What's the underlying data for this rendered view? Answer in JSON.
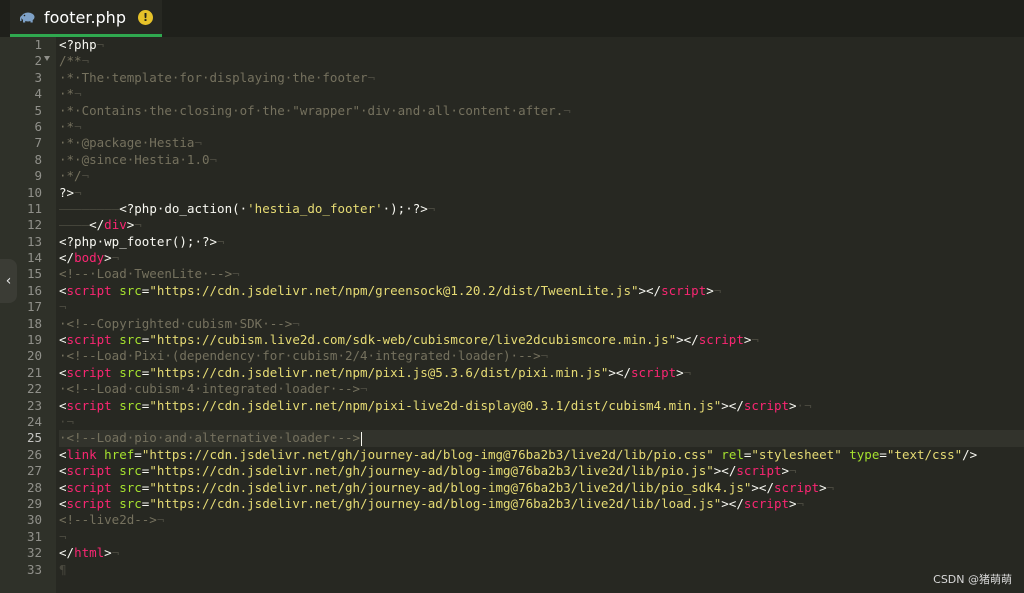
{
  "tab": {
    "title": "footer.php",
    "warning_glyph": "!",
    "icon": "php-elephant-icon"
  },
  "collapse_glyph": "‹",
  "watermark": "CSDN @猪萌萌",
  "active_line": 25,
  "colors": {
    "tag": "#f92672",
    "attr": "#a6e22e",
    "string": "#e6db74",
    "comment": "#75715e",
    "text": "#f8f8f2",
    "accent": "#2fa84f"
  },
  "lines": [
    {
      "n": "1",
      "t": [
        [
          "fn",
          "<?php"
        ],
        [
          "inv",
          "¬"
        ]
      ]
    },
    {
      "n": "2",
      "t": [
        [
          "cm",
          "/**"
        ],
        [
          "inv",
          "¬"
        ]
      ]
    },
    {
      "n": "3",
      "t": [
        [
          "cm",
          "·*·The·template·for·displaying·the·footer"
        ],
        [
          "inv",
          "¬"
        ]
      ]
    },
    {
      "n": "4",
      "t": [
        [
          "cm",
          "·*"
        ],
        [
          "inv",
          "¬"
        ]
      ]
    },
    {
      "n": "5",
      "t": [
        [
          "cm",
          "·*·Contains·the·closing·of·the·\"wrapper\"·div·and·all·content·after."
        ],
        [
          "inv",
          "¬"
        ]
      ]
    },
    {
      "n": "6",
      "t": [
        [
          "cm",
          "·*"
        ],
        [
          "inv",
          "¬"
        ]
      ]
    },
    {
      "n": "7",
      "t": [
        [
          "cm",
          "·*·@package·Hestia"
        ],
        [
          "inv",
          "¬"
        ]
      ]
    },
    {
      "n": "8",
      "t": [
        [
          "cm",
          "·*·@since·Hestia·1.0"
        ],
        [
          "inv",
          "¬"
        ]
      ]
    },
    {
      "n": "9",
      "t": [
        [
          "cm",
          "·*/"
        ],
        [
          "inv",
          "¬"
        ]
      ]
    },
    {
      "n": "10",
      "t": [
        [
          "fn",
          "?>"
        ],
        [
          "inv",
          "¬"
        ]
      ]
    },
    {
      "n": "11",
      "t": [
        [
          "inv",
          "————————"
        ],
        [
          "fn",
          "<?php·do_action(·"
        ],
        [
          "st",
          "'hestia_do_footer'"
        ],
        [
          "fn",
          "·);·?>"
        ],
        [
          "inv",
          "¬"
        ]
      ]
    },
    {
      "n": "12",
      "t": [
        [
          "inv",
          "————"
        ],
        [
          "fn",
          "</"
        ],
        [
          "kw",
          "div"
        ],
        [
          "fn",
          ">"
        ],
        [
          "inv",
          "¬"
        ]
      ]
    },
    {
      "n": "13",
      "t": [
        [
          "fn",
          "<?php·wp_footer();·?>"
        ],
        [
          "inv",
          "¬"
        ]
      ]
    },
    {
      "n": "14",
      "t": [
        [
          "fn",
          "</"
        ],
        [
          "kw",
          "body"
        ],
        [
          "fn",
          ">"
        ],
        [
          "inv",
          "¬"
        ]
      ]
    },
    {
      "n": "15",
      "t": [
        [
          "cm",
          "<!--·Load·TweenLite·-->"
        ],
        [
          "inv",
          "¬"
        ]
      ]
    },
    {
      "n": "16",
      "t": [
        [
          "fn",
          "<"
        ],
        [
          "kw",
          "script"
        ],
        [
          "fn",
          " "
        ],
        [
          "at",
          "src"
        ],
        [
          "fn",
          "="
        ],
        [
          "st",
          "\"https://cdn.jsdelivr.net/npm/greensock@1.20.2/dist/TweenLite.js\""
        ],
        [
          "fn",
          "></"
        ],
        [
          "kw",
          "script"
        ],
        [
          "fn",
          ">"
        ],
        [
          "inv",
          "¬"
        ]
      ]
    },
    {
      "n": "17",
      "t": [
        [
          "inv",
          "¬"
        ]
      ]
    },
    {
      "n": "18",
      "t": [
        [
          "cm",
          "·<!--Copyrighted·cubism·SDK·-->"
        ],
        [
          "inv",
          "¬"
        ]
      ]
    },
    {
      "n": "19",
      "t": [
        [
          "fn",
          "<"
        ],
        [
          "kw",
          "script"
        ],
        [
          "fn",
          " "
        ],
        [
          "at",
          "src"
        ],
        [
          "fn",
          "="
        ],
        [
          "st",
          "\"https://cubism.live2d.com/sdk-web/cubismcore/live2dcubismcore.min.js\""
        ],
        [
          "fn",
          "></"
        ],
        [
          "kw",
          "script"
        ],
        [
          "fn",
          ">"
        ],
        [
          "inv",
          "¬"
        ]
      ]
    },
    {
      "n": "20",
      "t": [
        [
          "cm",
          "·<!--Load·Pixi·(dependency·for·cubism·2/4·integrated·loader)·-->"
        ],
        [
          "inv",
          "¬"
        ]
      ]
    },
    {
      "n": "21",
      "t": [
        [
          "fn",
          "<"
        ],
        [
          "kw",
          "script"
        ],
        [
          "fn",
          " "
        ],
        [
          "at",
          "src"
        ],
        [
          "fn",
          "="
        ],
        [
          "st",
          "\"https://cdn.jsdelivr.net/npm/pixi.js@5.3.6/dist/pixi.min.js\""
        ],
        [
          "fn",
          "></"
        ],
        [
          "kw",
          "script"
        ],
        [
          "fn",
          ">"
        ],
        [
          "inv",
          "¬"
        ]
      ]
    },
    {
      "n": "22",
      "t": [
        [
          "cm",
          "·<!--Load·cubism·4·integrated·loader·-->"
        ],
        [
          "inv",
          "¬"
        ]
      ]
    },
    {
      "n": "23",
      "t": [
        [
          "fn",
          "<"
        ],
        [
          "kw",
          "script"
        ],
        [
          "fn",
          " "
        ],
        [
          "at",
          "src"
        ],
        [
          "fn",
          "="
        ],
        [
          "st",
          "\"https://cdn.jsdelivr.net/npm/pixi-live2d-display@0.3.1/dist/cubism4.min.js\""
        ],
        [
          "fn",
          "></"
        ],
        [
          "kw",
          "script"
        ],
        [
          "fn",
          ">"
        ],
        [
          "inv",
          "·¬"
        ]
      ]
    },
    {
      "n": "24",
      "t": [
        [
          "inv",
          "·¬"
        ]
      ]
    },
    {
      "n": "25",
      "t": [
        [
          "cm",
          "·<!--Load·pio·and·alternative·loader·-->"
        ]
      ]
    },
    {
      "n": "26",
      "t": [
        [
          "fn",
          "<"
        ],
        [
          "kw",
          "link"
        ],
        [
          "fn",
          " "
        ],
        [
          "at",
          "href"
        ],
        [
          "fn",
          "="
        ],
        [
          "st",
          "\"https://cdn.jsdelivr.net/gh/journey-ad/blog-img@76ba2b3/live2d/lib/pio.css\""
        ],
        [
          "fn",
          " "
        ],
        [
          "at",
          "rel"
        ],
        [
          "fn",
          "="
        ],
        [
          "st",
          "\"stylesheet\""
        ],
        [
          "fn",
          " "
        ],
        [
          "at",
          "type"
        ],
        [
          "fn",
          "="
        ],
        [
          "st",
          "\"text/css\""
        ],
        [
          "fn",
          "/>"
        ]
      ]
    },
    {
      "n": "27",
      "t": [
        [
          "fn",
          "<"
        ],
        [
          "kw",
          "script"
        ],
        [
          "fn",
          " "
        ],
        [
          "at",
          "src"
        ],
        [
          "fn",
          "="
        ],
        [
          "st",
          "\"https://cdn.jsdelivr.net/gh/journey-ad/blog-img@76ba2b3/live2d/lib/pio.js\""
        ],
        [
          "fn",
          "></"
        ],
        [
          "kw",
          "script"
        ],
        [
          "fn",
          ">"
        ],
        [
          "inv",
          "¬"
        ]
      ]
    },
    {
      "n": "28",
      "t": [
        [
          "fn",
          "<"
        ],
        [
          "kw",
          "script"
        ],
        [
          "fn",
          " "
        ],
        [
          "at",
          "src"
        ],
        [
          "fn",
          "="
        ],
        [
          "st",
          "\"https://cdn.jsdelivr.net/gh/journey-ad/blog-img@76ba2b3/live2d/lib/pio_sdk4.js\""
        ],
        [
          "fn",
          "></"
        ],
        [
          "kw",
          "script"
        ],
        [
          "fn",
          ">"
        ],
        [
          "inv",
          "¬"
        ]
      ]
    },
    {
      "n": "29",
      "t": [
        [
          "fn",
          "<"
        ],
        [
          "kw",
          "script"
        ],
        [
          "fn",
          " "
        ],
        [
          "at",
          "src"
        ],
        [
          "fn",
          "="
        ],
        [
          "st",
          "\"https://cdn.jsdelivr.net/gh/journey-ad/blog-img@76ba2b3/live2d/lib/load.js\""
        ],
        [
          "fn",
          "></"
        ],
        [
          "kw",
          "script"
        ],
        [
          "fn",
          ">"
        ],
        [
          "inv",
          "¬"
        ]
      ]
    },
    {
      "n": "30",
      "t": [
        [
          "cm",
          "<!--live2d-->"
        ],
        [
          "inv",
          "¬"
        ]
      ]
    },
    {
      "n": "31",
      "t": [
        [
          "inv",
          "¬"
        ]
      ]
    },
    {
      "n": "32",
      "t": [
        [
          "fn",
          "</"
        ],
        [
          "kw",
          "html"
        ],
        [
          "fn",
          ">"
        ],
        [
          "inv",
          "¬"
        ]
      ]
    },
    {
      "n": "33",
      "t": [
        [
          "inv",
          "¶"
        ]
      ]
    }
  ]
}
